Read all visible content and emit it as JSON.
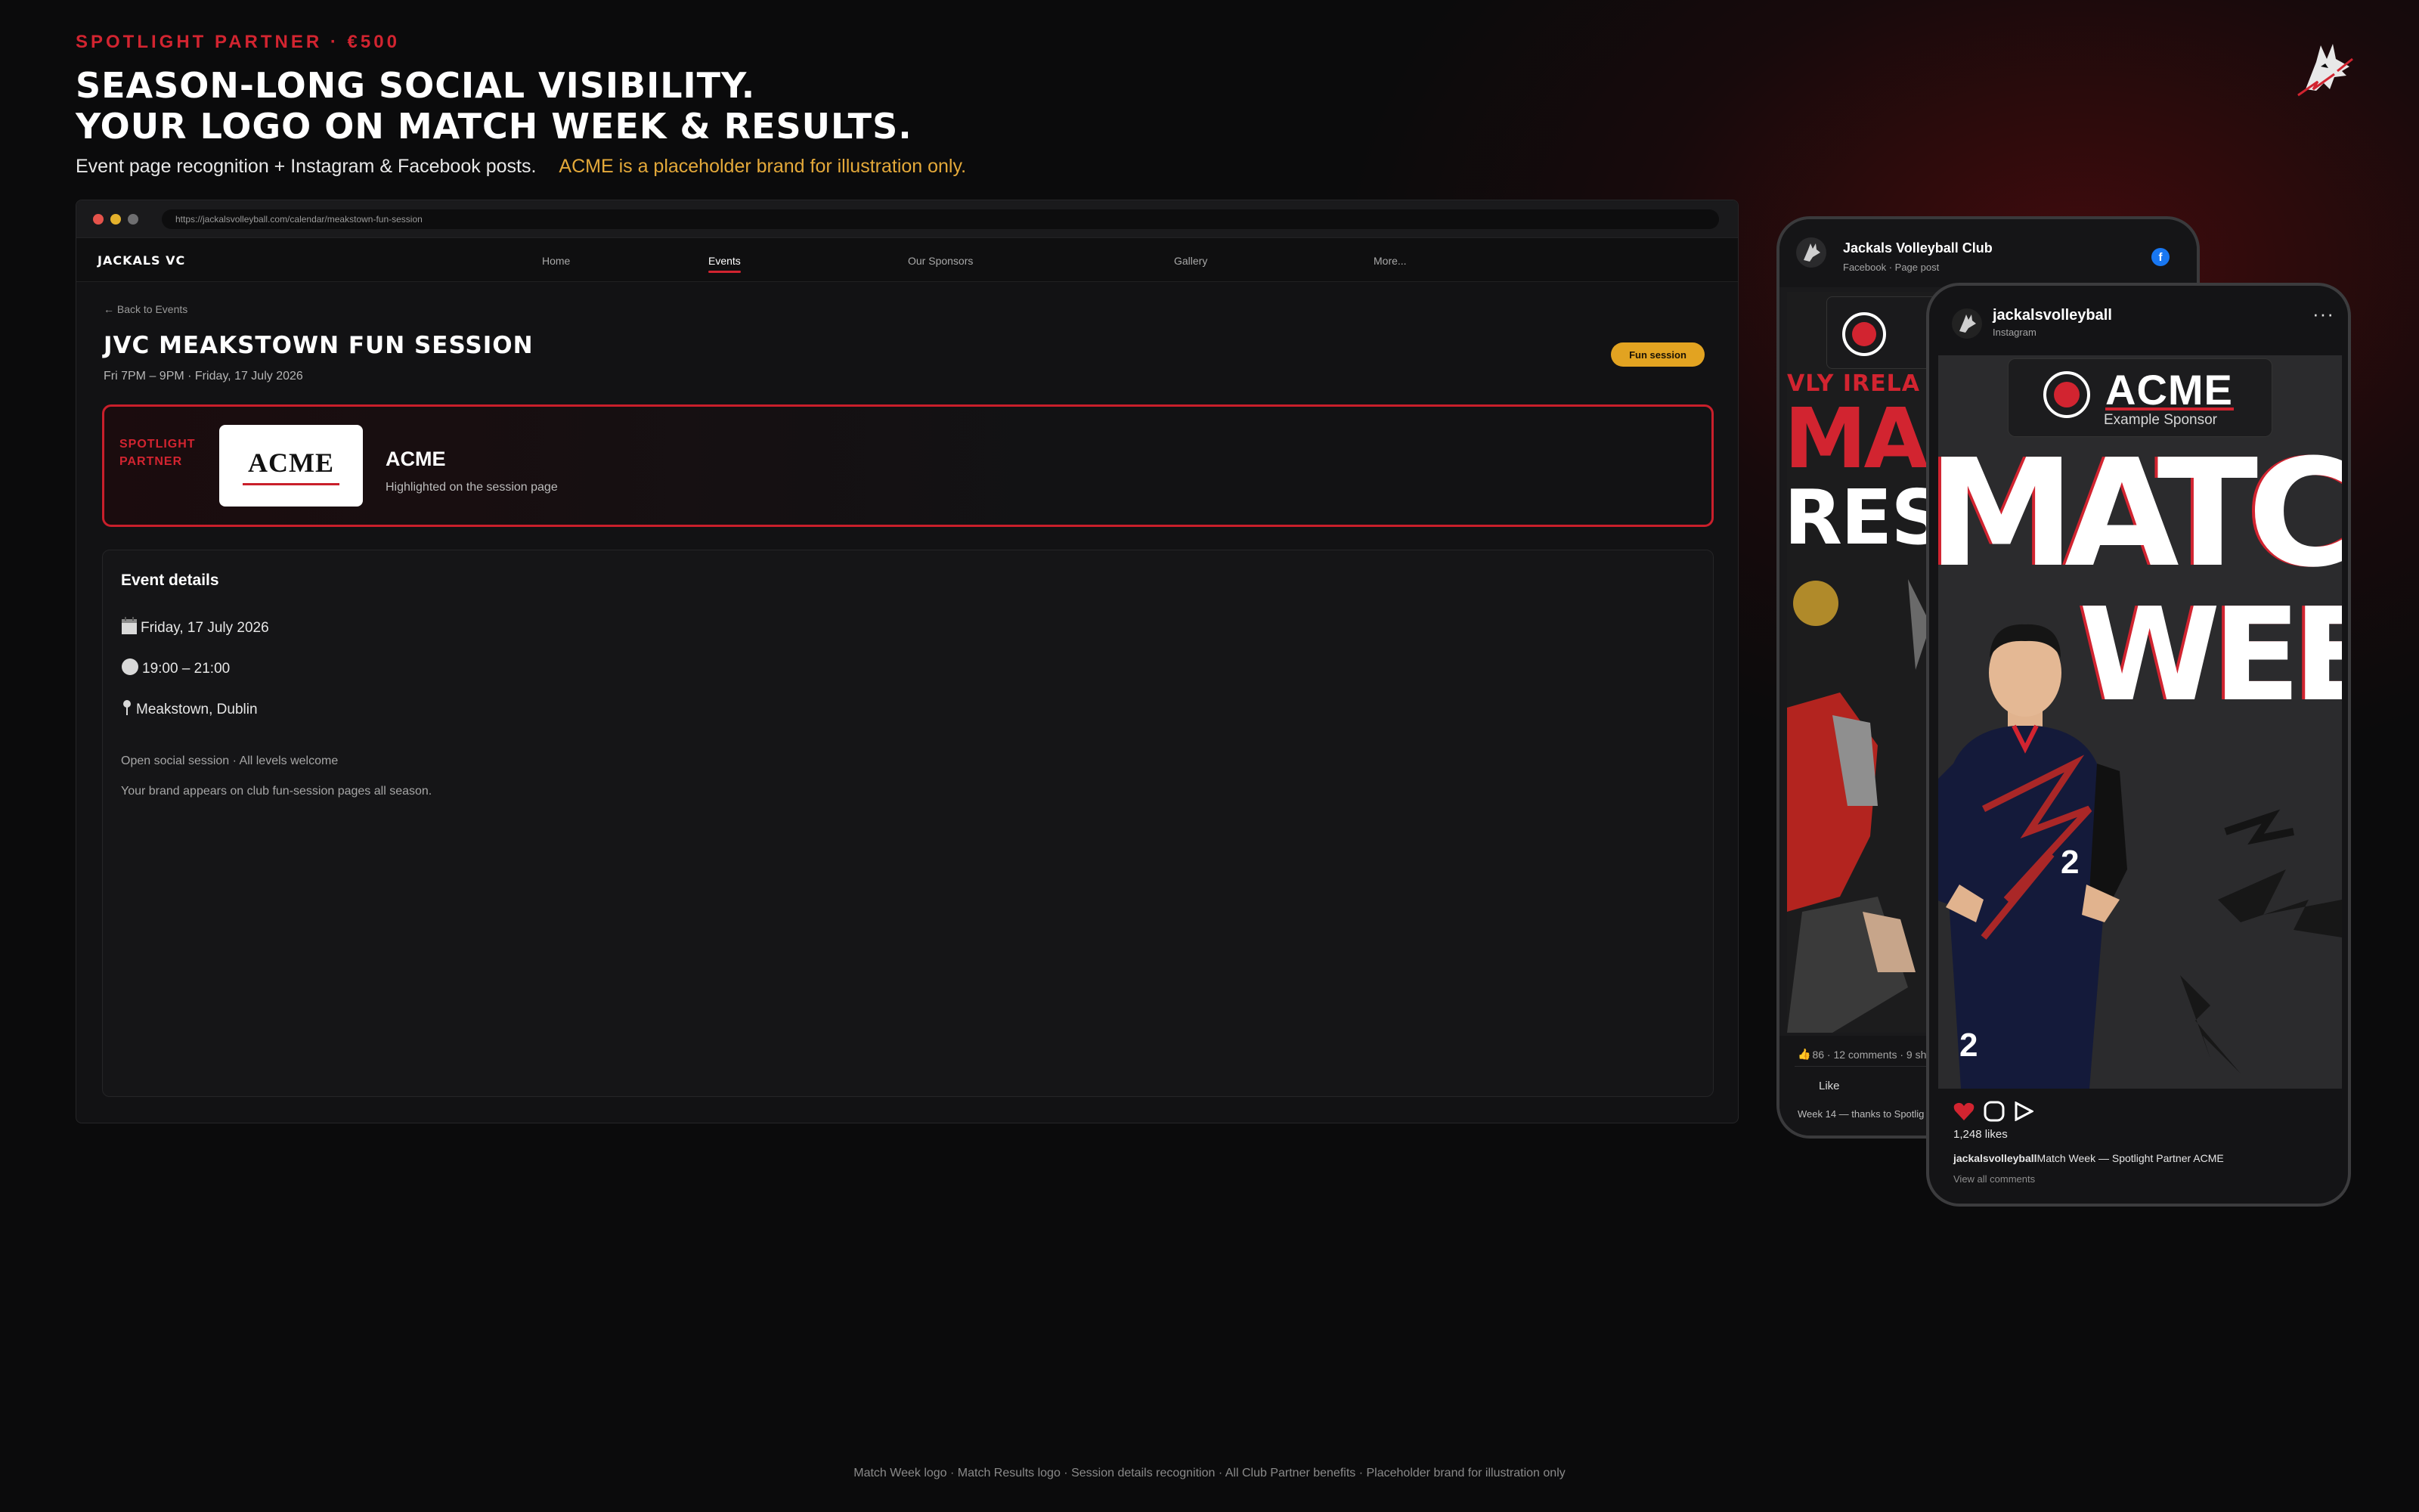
{
  "header": {
    "eyebrow": "SPOTLIGHT PARTNER · €500",
    "headline_1": "SEASON-LONG SOCIAL VISIBILITY.",
    "headline_2": "YOUR LOGO ON MATCH WEEK & RESULTS.",
    "subtitle": "Event page recognition + Instagram & Facebook posts.",
    "note": "ACME is a placeholder brand for illustration only.",
    "brand_icon": "wolf-logo-icon"
  },
  "browser": {
    "url": "https://jackalsvolleyball.com/calendar/meakstown-fun-session",
    "site_name": "JACKALS VC",
    "nav": [
      "Home",
      "Events",
      "Our Sponsors",
      "Gallery",
      "More..."
    ],
    "active_nav": "Events",
    "back_link": "← Back to Events",
    "event_title": "JVC MEAKSTOWN FUN SESSION",
    "event_datetime": "Fri 7PM – 9PM · Friday, 17 July 2026",
    "tag": "Fun session",
    "spotlight": {
      "label_1": "SPOTLIGHT",
      "label_2": "PARTNER",
      "logo_word": "ACME",
      "name": "ACME",
      "description": "Highlighted on the session page"
    },
    "details": {
      "heading": "Event details",
      "date": "Friday, 17 July 2026",
      "time": "19:00 – 21:00",
      "location": "Meakstown, Dublin",
      "line_1": "Open social session · All levels welcome",
      "line_2": "Your brand appears on club fun-session pages all season."
    }
  },
  "facebook": {
    "page_name": "Jackals Volleyball Club",
    "subtitle": "Facebook · Page post",
    "badge": "f",
    "image_text_1": "VLY IRELA",
    "image_text_2": "MA",
    "image_text_3": "RES",
    "stats": "86 · 12 comments · 9 sh",
    "like": "Like",
    "caption": "Week 14 — thanks to Spotlig"
  },
  "instagram": {
    "account": "jackalsvolleyball",
    "subtitle": "Instagram",
    "more": "···",
    "sponsor_logo": "ACME",
    "sponsor_label": "Example Sponsor",
    "image_text_1": "MATCH",
    "image_text_2": "WEE",
    "jersey_number": "2",
    "likes": "1,248 likes",
    "caption_user": "jackalsvolleyball",
    "caption_text": "Match Week — Spotlight Partner ACME",
    "view_comments": "View all comments"
  },
  "footer": "Match Week logo · Match Results logo · Session details recognition · All Club Partner benefits · Placeholder brand for illustration only",
  "colors": {
    "accent_red": "#d22430",
    "note_gold": "#e4a93a",
    "pill_gold": "#e2a321",
    "background": "#0b0b0c",
    "facebook_blue": "#1877f2"
  }
}
